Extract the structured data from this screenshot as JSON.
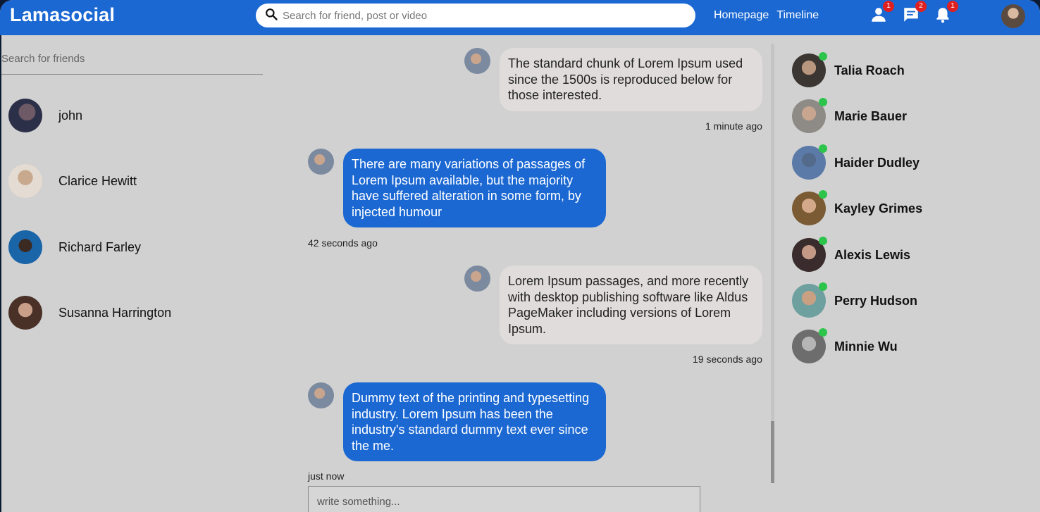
{
  "header": {
    "logo": "Lamasocial",
    "search_placeholder": "Search for friend, post or video",
    "nav": [
      "Homepage",
      "Timeline"
    ],
    "badges": {
      "friend_requests": "1",
      "messages": "2",
      "notifications": "1"
    }
  },
  "left": {
    "search_placeholder": "Search for friends",
    "conversations": [
      {
        "name": "john"
      },
      {
        "name": "Clarice Hewitt"
      },
      {
        "name": "Richard Farley"
      },
      {
        "name": "Susanna Harrington"
      }
    ]
  },
  "chat": {
    "messages": [
      {
        "own": true,
        "text": "The standard chunk of Lorem Ipsum used since the 1500s is reproduced below for those interested.",
        "time": "1 minute ago"
      },
      {
        "own": false,
        "text": "There are many variations of passages of Lorem Ipsum available, but the majority have suffered alteration in some form, by injected humour",
        "time": "42 seconds ago"
      },
      {
        "own": true,
        "text": "Lorem Ipsum passages, and more recently with desktop publishing software like Aldus PageMaker including versions of Lorem Ipsum.",
        "time": "19 seconds ago"
      },
      {
        "own": false,
        "text": "Dummy text of the printing and typesetting industry. Lorem Ipsum has been the industry's standard dummy text ever since the me.",
        "time": "just now"
      }
    ],
    "composer_placeholder": "write something..."
  },
  "online": [
    {
      "name": "Talia Roach"
    },
    {
      "name": "Marie Bauer"
    },
    {
      "name": "Haider Dudley"
    },
    {
      "name": "Kayley Grimes"
    },
    {
      "name": "Alexis Lewis"
    },
    {
      "name": "Perry Hudson"
    },
    {
      "name": "Minnie Wu"
    }
  ],
  "colors": {
    "brand": "#1b68d3",
    "online": "#2cc44a",
    "badge": "#e02020",
    "own_bubble": "#e1dcdc"
  }
}
